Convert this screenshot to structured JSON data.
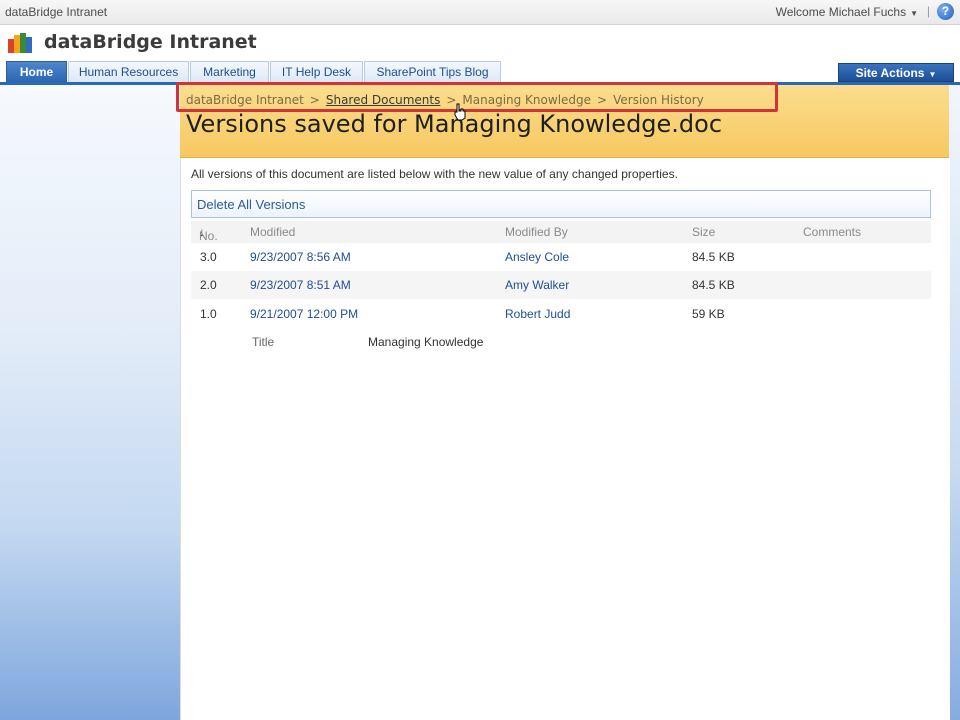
{
  "global": {
    "site_name": "dataBridge Intranet",
    "welcome": "Welcome Michael Fuchs",
    "help_icon": "help-icon"
  },
  "header": {
    "title": "dataBridge Intranet",
    "logo": "sharepoint-logo-icon"
  },
  "nav": {
    "tabs": [
      {
        "label": "Home",
        "active": true
      },
      {
        "label": "Human Resources"
      },
      {
        "label": "Marketing"
      },
      {
        "label": "IT Help Desk"
      },
      {
        "label": "SharePoint Tips Blog"
      }
    ],
    "site_actions": "Site Actions"
  },
  "breadcrumb": {
    "items": [
      "dataBridge Intranet",
      "Shared Documents",
      "Managing Knowledge",
      "Version History"
    ],
    "separator": ">"
  },
  "page": {
    "title": "Versions saved for Managing Knowledge.doc",
    "description": "All versions of this document are listed below with the new value of any changed properties."
  },
  "toolbar": {
    "delete_all": "Delete All Versions"
  },
  "table": {
    "columns": [
      "No.",
      "Modified",
      "Modified By",
      "Size",
      "Comments"
    ],
    "sort_icon": "sort-down-arrow-icon",
    "rows": [
      {
        "no": "3.0",
        "modified": "9/23/2007 8:56 AM",
        "modified_by": "Ansley Cole",
        "size": "84.5 KB",
        "comments": ""
      },
      {
        "no": "2.0",
        "modified": "9/23/2007 8:51 AM",
        "modified_by": "Amy Walker",
        "size": "84.5 KB",
        "comments": ""
      },
      {
        "no": "1.0",
        "modified": "9/21/2007 12:00 PM",
        "modified_by": "Robert Judd",
        "size": "59 KB",
        "comments": ""
      }
    ],
    "property_row": {
      "label": "Title",
      "value": "Managing Knowledge"
    }
  },
  "colors": {
    "nav_accent": "#2a67b4",
    "title_band": "#f6c860",
    "link": "#1f4e95",
    "highlight": "#d13438"
  }
}
